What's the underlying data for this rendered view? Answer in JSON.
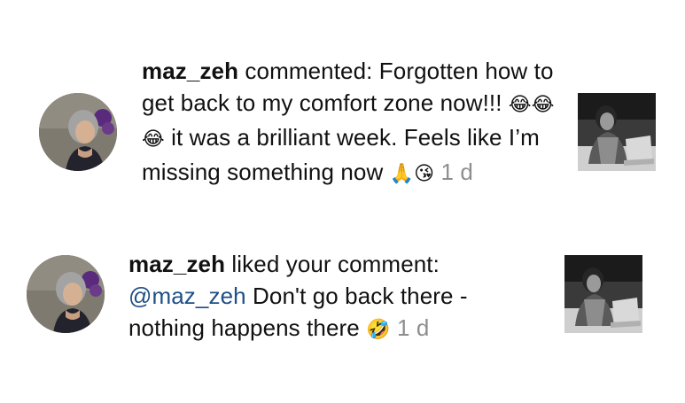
{
  "notifications": [
    {
      "username": "maz_zeh",
      "action": " commented: Forgotten how to get back to my comfort zone now!!! ",
      "emoji1": "😂😂😂",
      "rest": " it was a brilliant week. Feels like I’m missing something now ",
      "emoji2": "🙏😘",
      "time": " 1 d"
    },
    {
      "username": "maz_zeh",
      "action": " liked your comment: ",
      "mention": "@maz_zeh",
      "rest": " Don't go back there - nothing happens there ",
      "emoji": "🤣",
      "time": " 1 d"
    }
  ]
}
